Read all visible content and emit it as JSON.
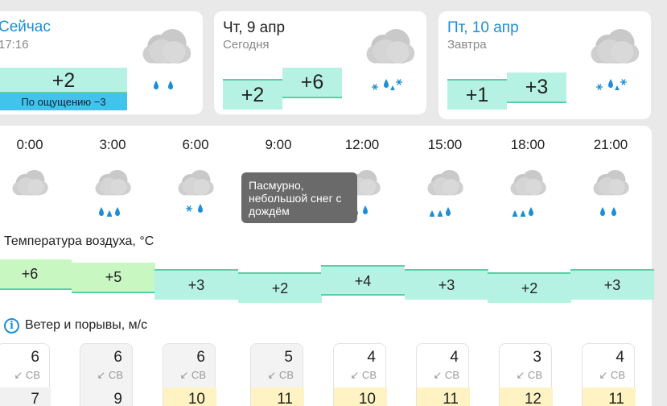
{
  "now": {
    "title": "Сейчас",
    "time": "17:16",
    "temp": "+2",
    "feels": "По ощущению −3",
    "icon": "cloud-rain-icon"
  },
  "today": {
    "title": "Чт, 9 апр",
    "subtitle": "Сегодня",
    "temp_low": "+2",
    "temp_high": "+6",
    "icon": "cloud-snow-rain-icon"
  },
  "tomorrow": {
    "title": "Пт, 10 апр",
    "subtitle": "Завтра",
    "temp_low": "+1",
    "temp_high": "+3",
    "icon": "cloud-snow-rain-icon"
  },
  "hourly": {
    "hours": [
      "0:00",
      "3:00",
      "6:00",
      "9:00",
      "12:00",
      "15:00",
      "18:00",
      "21:00"
    ],
    "icons": [
      "cloud-icon",
      "cloud-rain-icon",
      "cloud-snow-rain-icon",
      "cloud-snow-rain-icon",
      "cloud-snow-rain-icon",
      "cloud-rain-icon",
      "cloud-rain-icon",
      "cloud-rain-icon"
    ],
    "tooltip": "Пасмурно, небольшой снег с дождём"
  },
  "temperature": {
    "title": "Температура воздуха, °C",
    "values": [
      "+6",
      "+5",
      "+3",
      "+2",
      "+4",
      "+3",
      "+2",
      "+3"
    ],
    "numeric": [
      6,
      5,
      3,
      2,
      4,
      3,
      2,
      3
    ]
  },
  "wind": {
    "title": "Ветер и порывы, м/с",
    "speeds": [
      "6",
      "6",
      "6",
      "5",
      "4",
      "4",
      "3",
      "4"
    ],
    "directions": [
      "↙ СВ",
      "↙ СВ",
      "↙ СВ",
      "↙ СВ",
      "↙ СВ",
      "↙ СВ",
      "↙ СВ",
      "↙ СВ"
    ],
    "gusts": [
      "7",
      "9",
      "10",
      "11",
      "10",
      "11",
      "12",
      "11"
    ]
  },
  "colors": {
    "accent": "#1a8fd6",
    "temp_bar": "#b6f2e3",
    "temp_bar_warm": "#c9f7c2",
    "temp_line": "#59cfa6",
    "feels_bg": "#42c3ec",
    "gust_yellow": "#fff3c4"
  }
}
